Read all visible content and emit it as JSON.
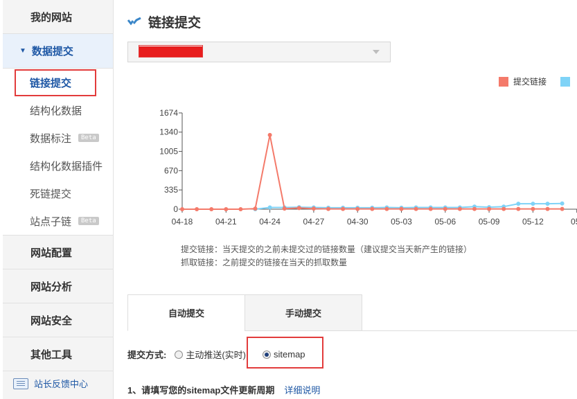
{
  "sidebar": {
    "groups_top": [
      {
        "label": "我的网站"
      }
    ],
    "active_group": {
      "label": "数据提交"
    },
    "sub_items": [
      {
        "label": "链接提交"
      },
      {
        "label": "结构化数据"
      },
      {
        "label": "数据标注",
        "badge": "Beta"
      },
      {
        "label": "结构化数据插件"
      },
      {
        "label": "死链提交"
      },
      {
        "label": "站点子链",
        "badge": "Beta"
      }
    ],
    "groups_bottom": [
      {
        "label": "网站配置"
      },
      {
        "label": "网站分析"
      },
      {
        "label": "网站安全"
      },
      {
        "label": "其他工具"
      }
    ],
    "feedback_label": "站长反馈中心"
  },
  "main": {
    "title": "链接提交",
    "site_select": {
      "value": "redacted"
    },
    "notes": [
      "提交链接：当天提交的之前未提交过的链接数量（建议提交当天新产生的链接）",
      "抓取链接：之前提交的链接在当天的抓取数量"
    ],
    "tabs": [
      {
        "label": "自动提交"
      },
      {
        "label": "手动提交"
      }
    ],
    "method": {
      "label": "提交方式:",
      "options": [
        "主动推送(实时)",
        "sitemap"
      ],
      "selected": "sitemap"
    },
    "step1": {
      "text": "1、请填写您的sitemap文件更新周期",
      "link": "详细说明"
    }
  },
  "colors": {
    "submit": "#f47a6a",
    "crawl": "#7fd3f7",
    "accent": "#1f58a5",
    "highlight": "#e23b3b"
  },
  "chart_data": {
    "type": "line",
    "x": [
      "04-18",
      "04-19",
      "04-20",
      "04-21",
      "04-22",
      "04-23",
      "04-24",
      "04-25",
      "04-26",
      "04-27",
      "04-28",
      "04-29",
      "04-30",
      "05-01",
      "05-02",
      "05-03",
      "05-04",
      "05-05",
      "05-06",
      "05-07",
      "05-08",
      "05-09",
      "05-10",
      "05-11",
      "05-12",
      "05-13",
      "05-14"
    ],
    "x_tick_labels": [
      "04-18",
      "04-21",
      "04-24",
      "04-27",
      "04-30",
      "05-03",
      "05-06",
      "05-09",
      "05-12",
      "05-"
    ],
    "y_tick_labels": [
      "1674",
      "1340",
      "1005",
      "670",
      "335",
      "0"
    ],
    "ylim": [
      0,
      1674
    ],
    "series": [
      {
        "name": "提交链接",
        "color": "#f47a6a",
        "values": [
          0,
          0,
          0,
          0,
          0,
          10,
          1290,
          10,
          20,
          10,
          5,
          5,
          5,
          5,
          5,
          5,
          5,
          5,
          5,
          5,
          5,
          5,
          5,
          5,
          5,
          5,
          5
        ]
      },
      {
        "name": "抓取链接",
        "color": "#7fd3f7",
        "values": [
          null,
          null,
          null,
          null,
          null,
          0,
          30,
          30,
          35,
          30,
          25,
          25,
          25,
          25,
          30,
          25,
          30,
          30,
          30,
          30,
          45,
          35,
          45,
          95,
          95,
          95,
          100
        ]
      }
    ]
  }
}
